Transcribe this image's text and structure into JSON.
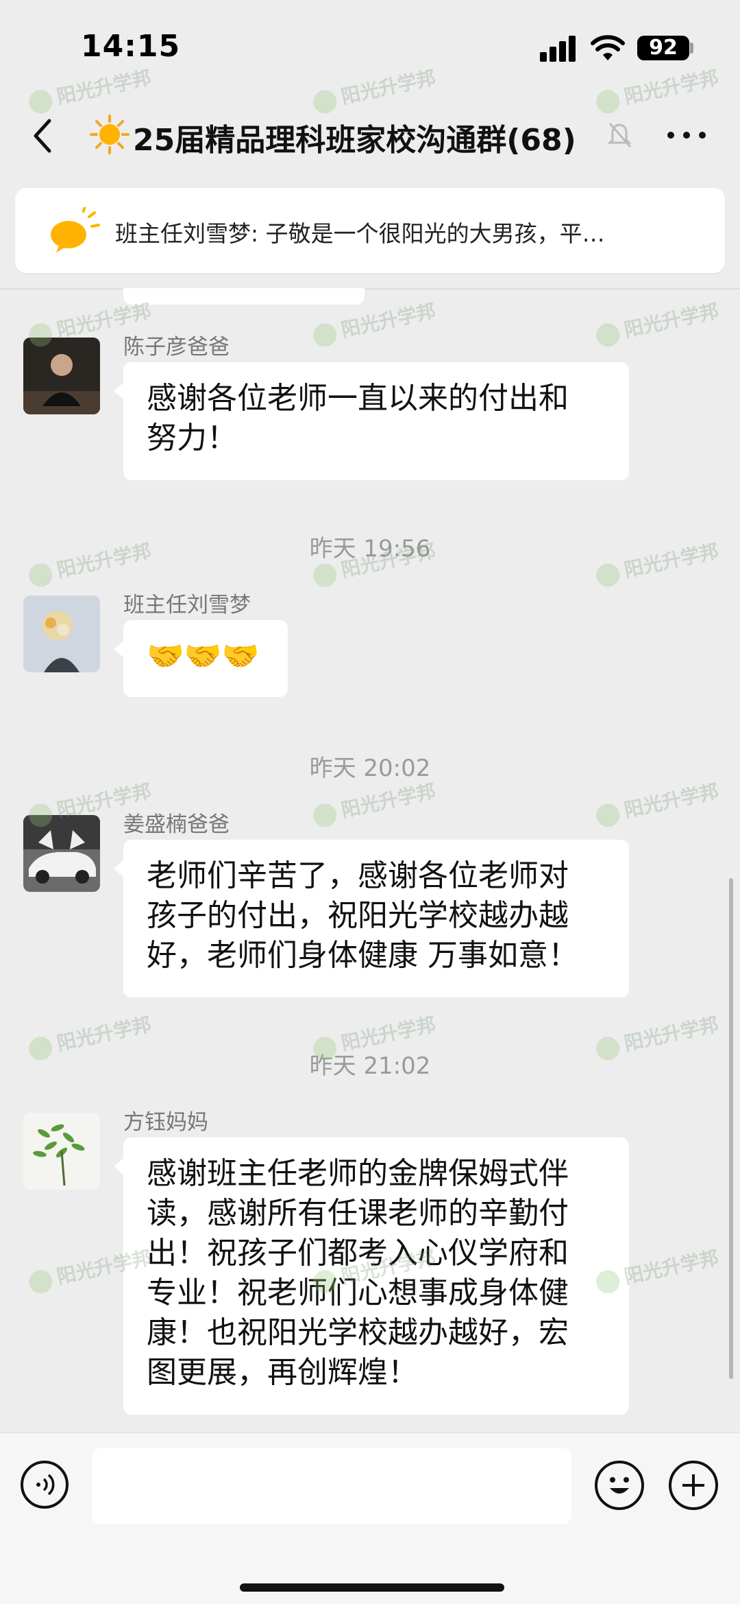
{
  "status_bar": {
    "time": "14:15",
    "battery": "92"
  },
  "nav": {
    "title": "25届精品理科班家校沟通群(68)",
    "title_emoji": "sun"
  },
  "pinned": {
    "text": "班主任刘雪梦: 子敬是一个很阳光的大男孩，平…"
  },
  "watermark": "阳光升学邦",
  "messages": [
    {
      "sender": "陈子彦爸爸",
      "text": "感谢各位老师一直以来的付出和\n努力！"
    },
    {
      "timestamp": "昨天 19:56"
    },
    {
      "sender": "班主任刘雪梦",
      "text": "🤝🤝🤝"
    },
    {
      "timestamp": "昨天 20:02"
    },
    {
      "sender": "姜盛楠爸爸",
      "text": "老师们辛苦了，感谢各位老师对\n孩子的付出，祝阳光学校越办越\n好，老师们身体健康 万事如意！"
    },
    {
      "timestamp": "昨天 21:02"
    },
    {
      "sender": "方钰妈妈",
      "text": "感谢班主任老师的金牌保姆式伴\n读，感谢所有任课老师的辛勤付\n出！祝孩子们都考入心仪学府和\n专业！祝老师们心想事成身体健\n康！也祝阳光学校越办越好，宏\n图更展，再创辉煌！"
    }
  ],
  "input": {
    "placeholder": ""
  },
  "colors": {
    "background": "#ededed",
    "bubble": "#ffffff",
    "timestamp": "#9a9a9a"
  }
}
